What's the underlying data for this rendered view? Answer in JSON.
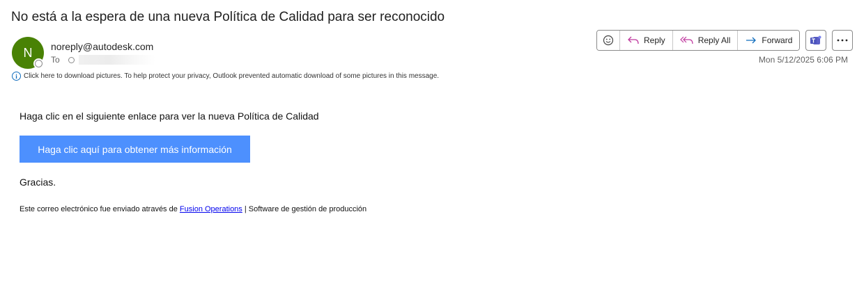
{
  "email": {
    "subject": "No está a la espera de una nueva Política de Calidad para ser reconocido",
    "sender": {
      "initial": "N",
      "address": "noreply@autodesk.com",
      "avatar_color": "#498205"
    },
    "to_label": "To",
    "date": "Mon 5/12/2025 6:06 PM",
    "info_bar": "Click here to download pictures. To help protect your privacy, Outlook prevented automatic download of some pictures in this message."
  },
  "toolbar": {
    "emoji_icon": "smiley-icon",
    "reply_label": "Reply",
    "reply_all_label": "Reply All",
    "forward_label": "Forward",
    "teams_icon": "teams-icon",
    "more_icon": "more-horizontal-icon"
  },
  "message": {
    "intro": "Haga clic en el siguiente enlace para ver la nueva Política de Calidad",
    "button_label": "Haga clic aquí para obtener más información",
    "button_color": "#4d90fe",
    "thanks": "Gracias.",
    "footer_prefix": "Este correo electrónico fue enviado através de ",
    "footer_link": "Fusion Operations",
    "footer_suffix": " | Software de gestión de producción"
  }
}
